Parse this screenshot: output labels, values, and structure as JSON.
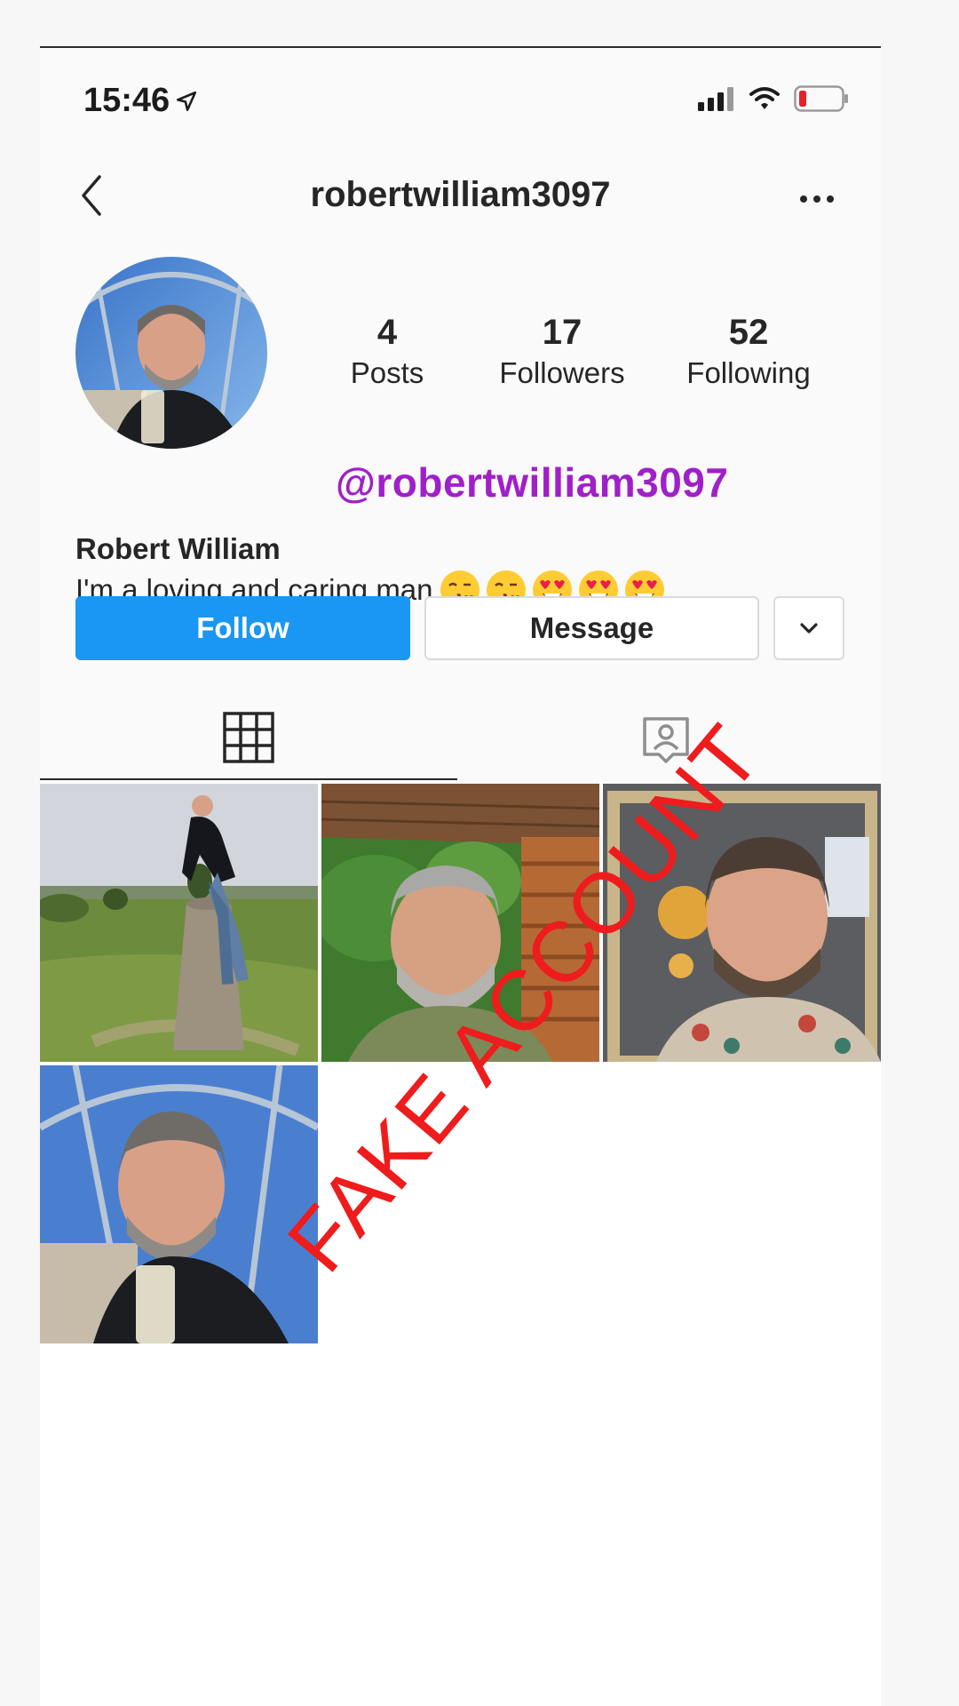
{
  "status_bar": {
    "time": "15:46"
  },
  "nav": {
    "title": "robertwilliam3097"
  },
  "profile": {
    "stats": [
      {
        "value": "4",
        "label": "Posts"
      },
      {
        "value": "17",
        "label": "Followers"
      },
      {
        "value": "52",
        "label": "Following"
      }
    ],
    "overlay_handle": "@robertwilliam3097",
    "display_name": "Robert William",
    "bio_text": "I'm a loving and caring man",
    "bio_emojis": [
      "kissing-face-emoji",
      "kissing-face-emoji",
      "heart-eyes-emoji",
      "heart-eyes-emoji",
      "heart-eyes-emoji"
    ]
  },
  "actions": {
    "follow_label": "Follow",
    "message_label": "Message"
  },
  "tabs": [
    "grid-icon",
    "tagged-icon"
  ],
  "posts": [
    "post-photo-trig-point",
    "post-photo-cabin-selfie",
    "post-photo-restaurant-selfie",
    "post-photo-champagne-selfie"
  ],
  "stamp": {
    "text": "FAKE ACCOUNT",
    "color": "#ee1c1c"
  },
  "colors": {
    "follow_button": "#1997f3",
    "handle_overlay": "#a020c8"
  }
}
